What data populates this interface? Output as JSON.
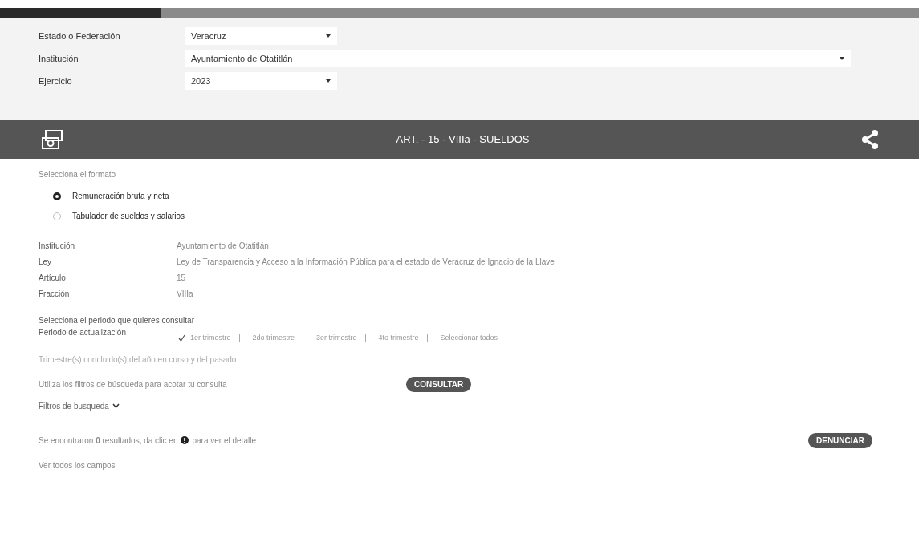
{
  "filters": [
    {
      "label": "Estado o Federación",
      "value": "Veracruz",
      "wide": false
    },
    {
      "label": "Institución",
      "value": "Ayuntamiento de Otatitlán",
      "wide": true
    },
    {
      "label": "Ejercicio",
      "value": "2023",
      "wide": false
    }
  ],
  "banner": {
    "title": "ART. - 15 - VIIIa - SUELDOS"
  },
  "format": {
    "prompt": "Selecciona el formato",
    "options": [
      {
        "label": "Remuneración bruta y neta",
        "selected": true
      },
      {
        "label": "Tabulador de sueldos y salarios",
        "selected": false
      }
    ]
  },
  "details": [
    {
      "label": "Institución",
      "value": "Ayuntamiento de Otatitlán"
    },
    {
      "label": "Ley",
      "value": "Ley de Transparencia y Acceso a la Información Pública para el estado de Veracruz de Ignacio de la Llave"
    },
    {
      "label": "Artículo",
      "value": "15"
    },
    {
      "label": "Fracción",
      "value": "VIIIa"
    }
  ],
  "period": {
    "prompt": "Selecciona el periodo que quieres consultar",
    "label": "Periodo de actualización",
    "options": [
      {
        "label": "1er trimestre",
        "checked": true
      },
      {
        "label": "2do trimestre",
        "checked": false
      },
      {
        "label": "3er trimestre",
        "checked": false
      },
      {
        "label": "4to trimestre",
        "checked": false
      },
      {
        "label": "Seleccionar todos",
        "checked": false
      }
    ],
    "note": "Trimestre(s) concluido(s) del año en curso y del pasado"
  },
  "search": {
    "hint": "Utiliza los filtros de búsqueda para acotar tu consulta",
    "button": "CONSULTAR",
    "filters_toggle": "Filtros de busqueda"
  },
  "results": {
    "text_before": "Se encontraron **0** resultados, da clic en",
    "text_after": "para ver el detalle",
    "button": "DENUNCIAR",
    "show_all": "Ver todos los campos"
  }
}
